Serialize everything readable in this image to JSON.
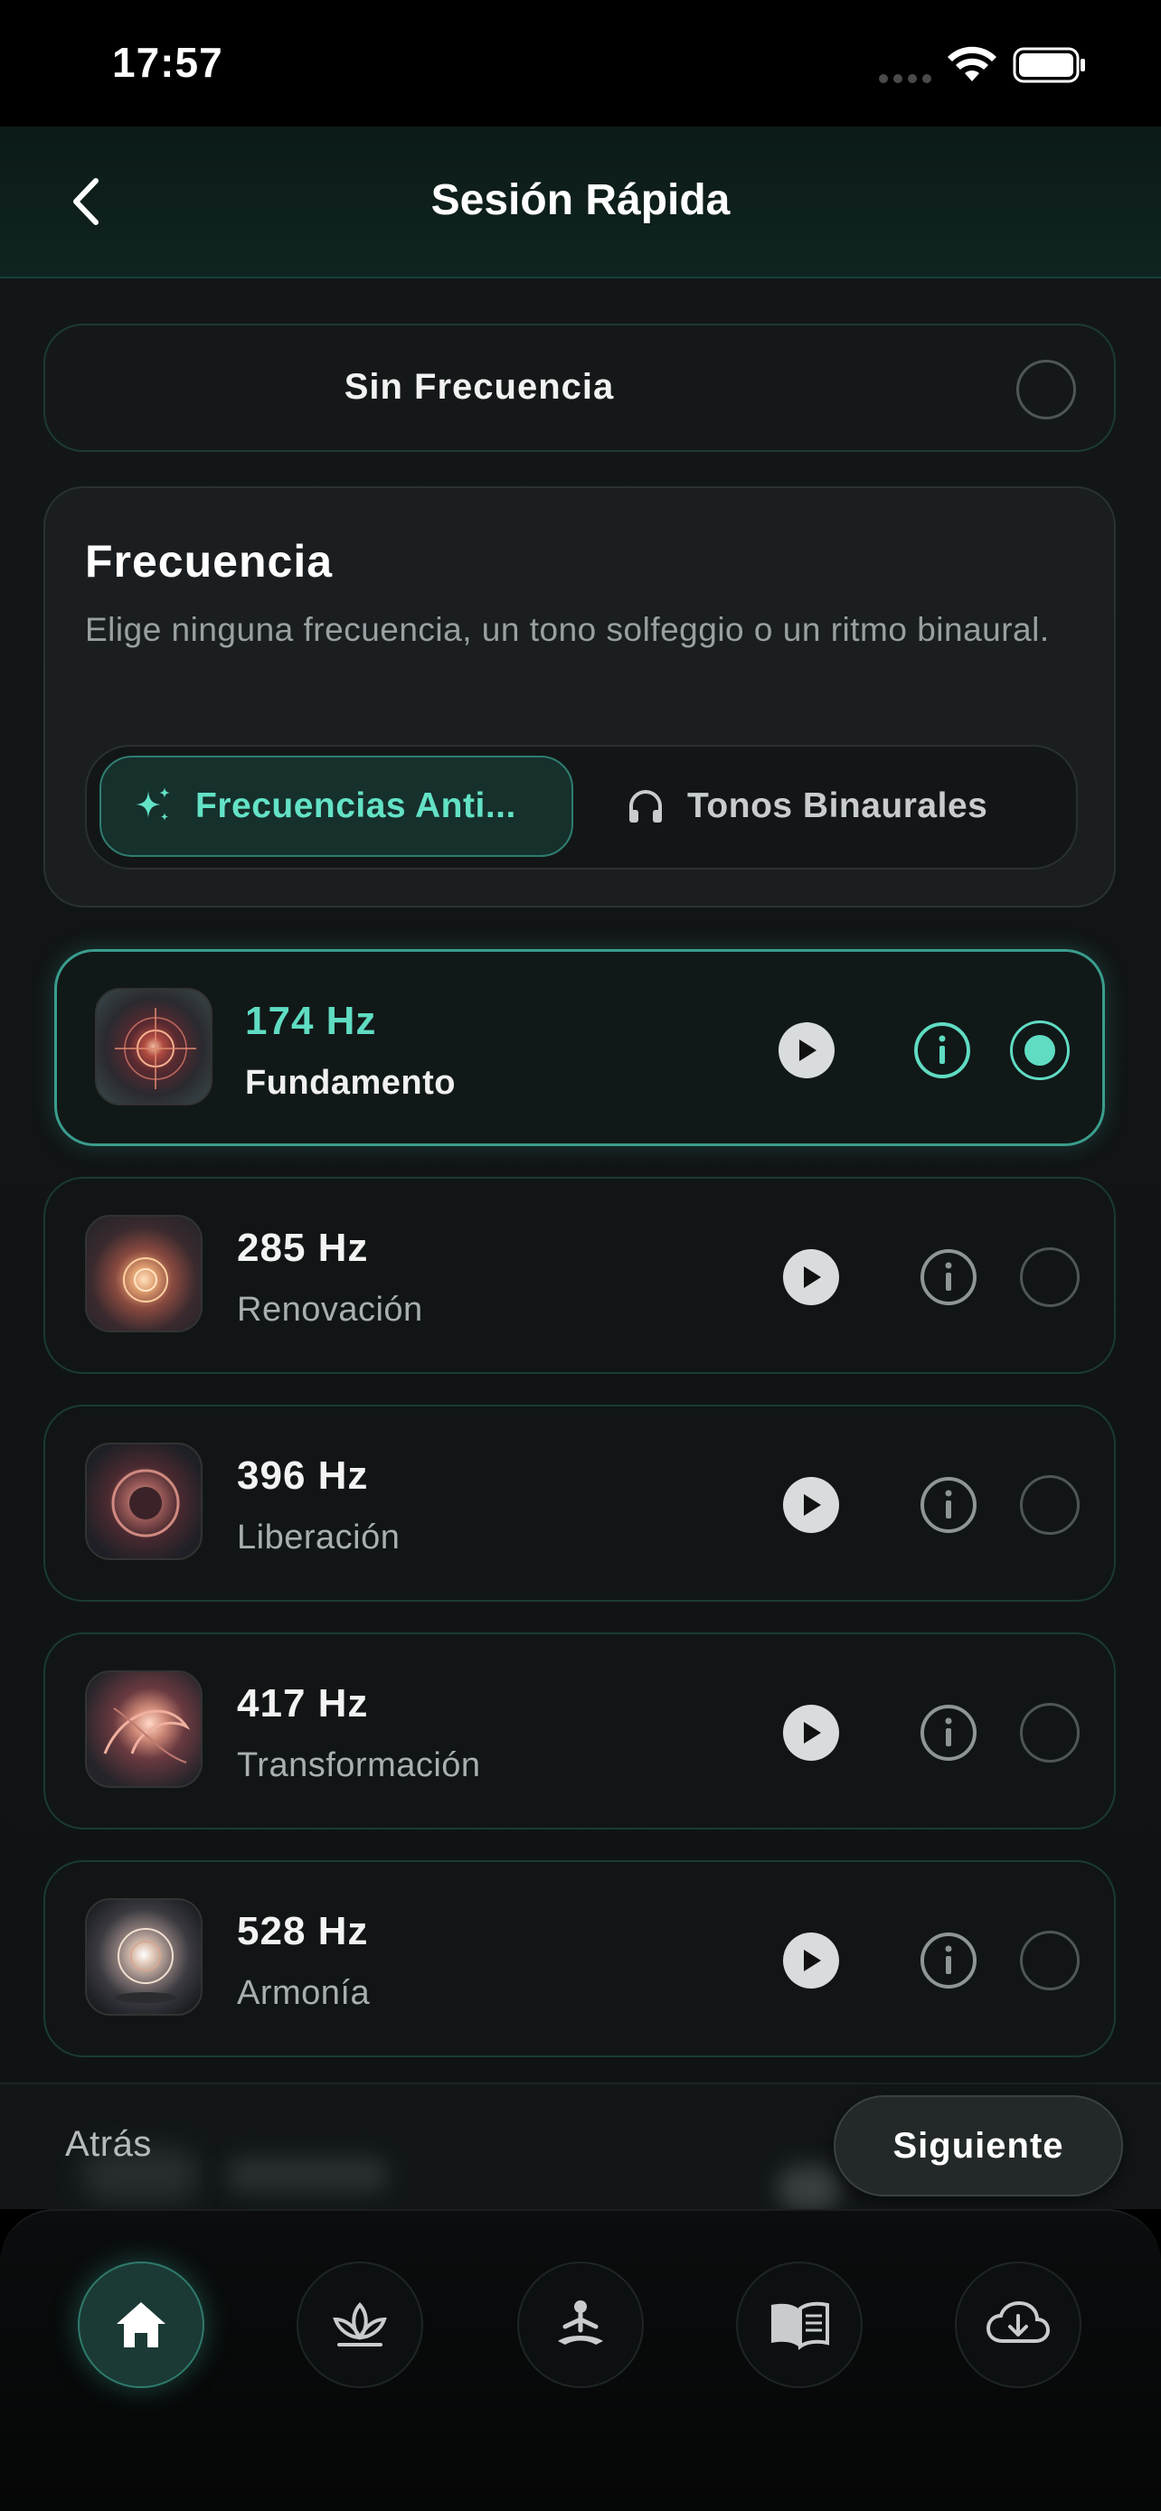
{
  "status_bar": {
    "time": "17:57"
  },
  "nav": {
    "title": "Sesión Rápida"
  },
  "no_frequency": {
    "label": "Sin Frecuencia"
  },
  "frequency_section": {
    "title": "Frecuencia",
    "description": "Elige ninguna frecuencia, un tono solfeggio o un ritmo binaural.",
    "tabs": [
      {
        "label": "Frecuencias Anti...",
        "icon": "sparkles-icon",
        "active": true
      },
      {
        "label": "Tonos Binaurales",
        "icon": "headphones-icon",
        "active": false
      }
    ]
  },
  "frequencies": [
    {
      "hz": "174 Hz",
      "name": "Fundamento",
      "selected": true
    },
    {
      "hz": "285 Hz",
      "name": "Renovación",
      "selected": false
    },
    {
      "hz": "396 Hz",
      "name": "Liberación",
      "selected": false
    },
    {
      "hz": "417 Hz",
      "name": "Transformación",
      "selected": false
    },
    {
      "hz": "528 Hz",
      "name": "Armonía",
      "selected": false
    }
  ],
  "footer": {
    "back_label": "Atrás",
    "next_label": "Siguiente"
  },
  "tab_bar": [
    {
      "icon": "home-icon",
      "active": true
    },
    {
      "icon": "lotus-icon",
      "active": false
    },
    {
      "icon": "meditation-icon",
      "active": false
    },
    {
      "icon": "book-icon",
      "active": false
    },
    {
      "icon": "cloud-download-icon",
      "active": false
    }
  ],
  "colors": {
    "accent": "#5fdcc2",
    "background": "#111516",
    "border": "#1b3a35"
  }
}
